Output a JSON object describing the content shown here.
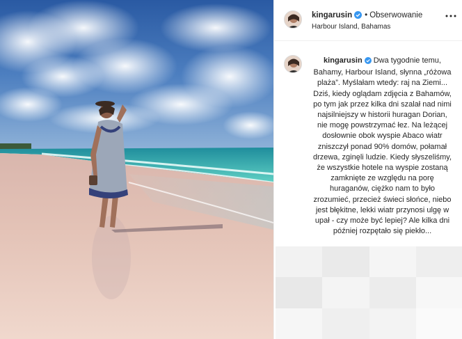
{
  "post": {
    "location": "Harbour Island, Bahamas",
    "photo_alt": "Woman in a dress standing on a pink sand beach by the sea"
  },
  "header": {
    "username": "kingarusin",
    "separator": "•",
    "follow_label": "Obserwowanie",
    "more_icon": "more-horizontal-icon"
  },
  "caption": {
    "username": "kingarusin",
    "text": "Dwa tygodnie temu, Bahamy, Harbour Island, słynna „różowa plaża”. Myślałam wtedy: raj na Ziemi... Dziś, kiedy oglądam zdjęcia z Bahamów, po tym jak przez kilka dni szalał nad nimi najsilniejszy w historii huragan Dorian, nie mogę powstrzymać łez. Na leżącej dosłownie obok wyspie Abaco wiatr zniszczył ponad 90% domów, połamał drzewa, zginęli ludzie. Kiedy słyszeliśmy, że wszystkie hotele na wyspie zostaną zamknięte ze względu na porę huraganów, ciężko nam to było zrozumieć, przecież świeci słońce, niebo jest błękitne, lekki wiatr przynosi ulgę w upał - czy może być lepiej? Ale kilka dni później rozpętało się piekło..."
  },
  "colors": {
    "verified_badge": "#3897f0",
    "sky_top": "#2f5fa6",
    "sea": "#2fb8b3",
    "sand": "#e9cdc2",
    "border": "#efefef",
    "text": "#262626"
  }
}
